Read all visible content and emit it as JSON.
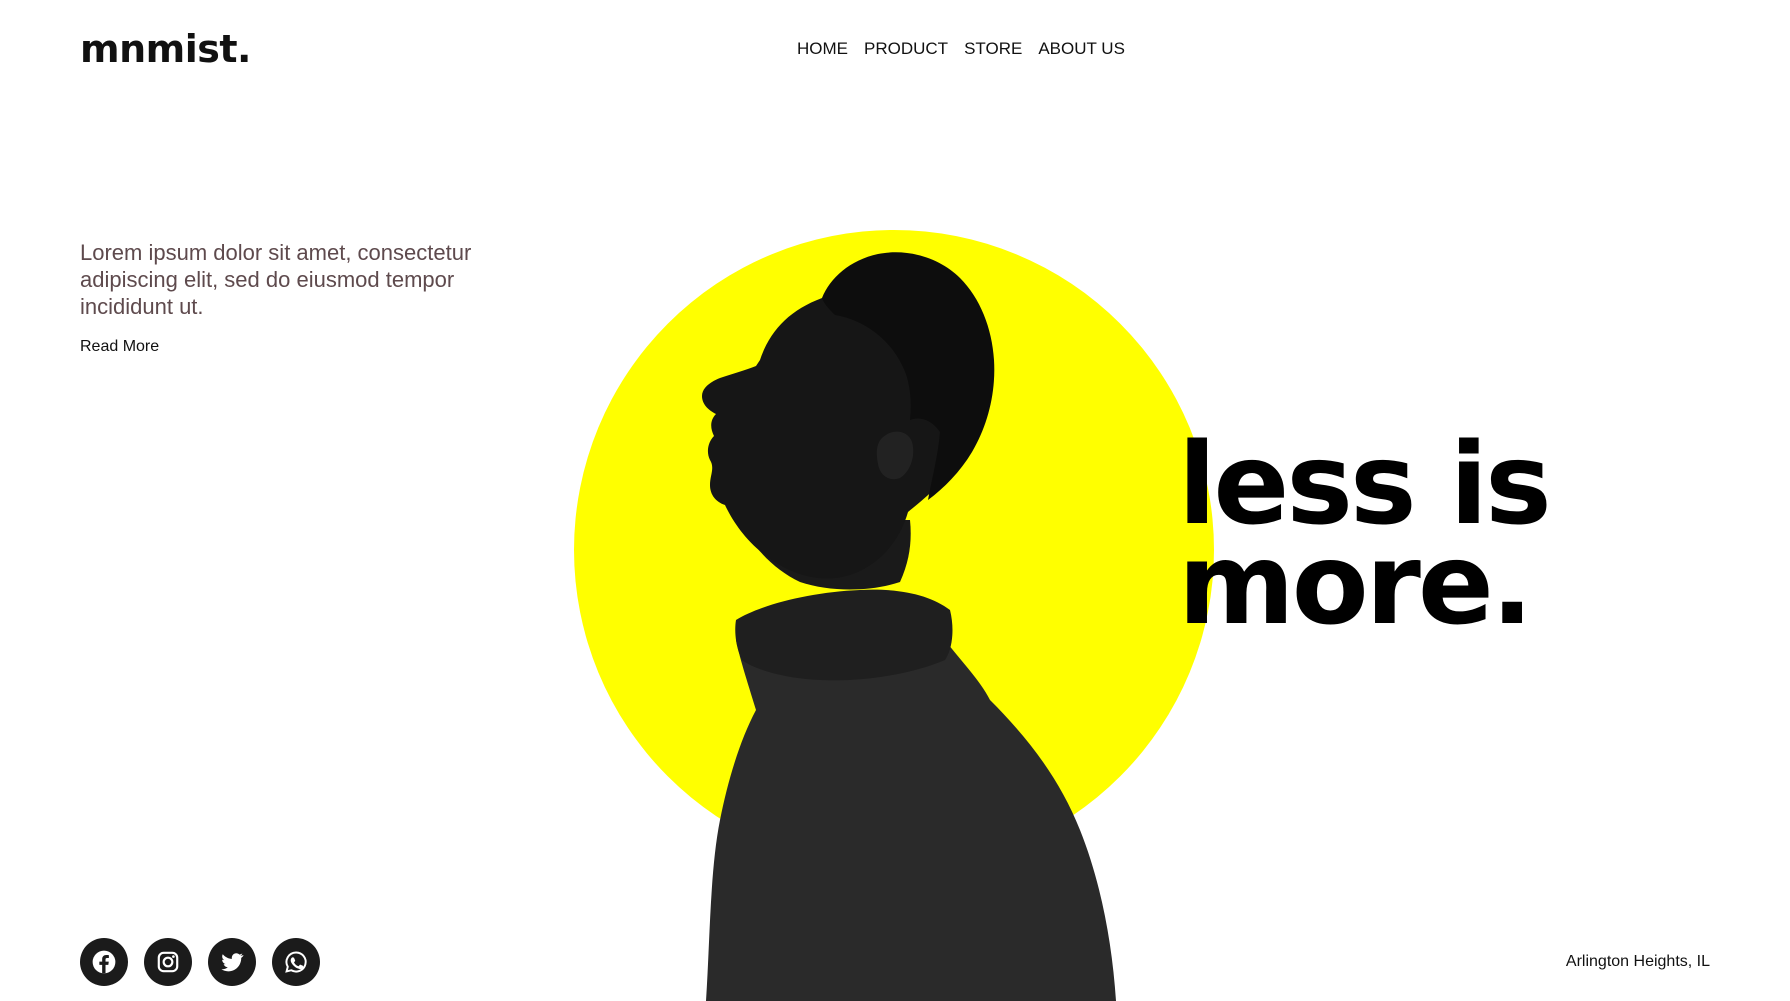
{
  "brand": {
    "logo_text": "mnmist."
  },
  "nav": {
    "items": [
      {
        "label": "HOME"
      },
      {
        "label": "PRODUCT"
      },
      {
        "label": "STORE"
      },
      {
        "label": "ABOUT US"
      }
    ]
  },
  "intro": {
    "text": "Lorem ipsum dolor sit amet, consectetur adipiscing elit, sed do eiusmod tempor incididunt ut.",
    "read_more_label": "Read More"
  },
  "hero": {
    "headline_line1": "less is",
    "headline_line2": "more.",
    "accent_color": "#ffff00",
    "image_icon": "portrait-profile-man-icon"
  },
  "socials": {
    "icons": [
      "facebook-icon",
      "instagram-icon",
      "twitter-icon",
      "whatsapp-icon"
    ]
  },
  "footer": {
    "location": "Arlington Heights, IL"
  },
  "colors": {
    "text_dark": "#111111",
    "intro_text": "#5e4a4d",
    "social_bg": "#1b1b1b",
    "accent": "#ffff00"
  }
}
